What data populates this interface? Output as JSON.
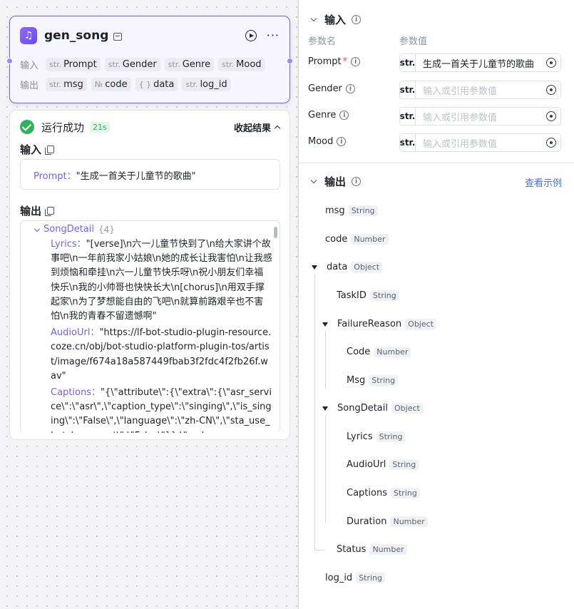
{
  "node": {
    "title": "gen_song",
    "inputs_label": "输入",
    "outputs_label": "输出",
    "inputs": [
      {
        "type": "str.",
        "name": "Prompt"
      },
      {
        "type": "str.",
        "name": "Gender"
      },
      {
        "type": "str.",
        "name": "Genre"
      },
      {
        "type": "str.",
        "name": "Mood"
      }
    ],
    "outputs": [
      {
        "type": "str.",
        "name": "msg"
      },
      {
        "type": "№",
        "name": "code"
      },
      {
        "type": "{ }",
        "name": "data"
      },
      {
        "type": "str.",
        "name": "log_id"
      }
    ]
  },
  "result": {
    "status": "运行成功",
    "duration": "21s",
    "collapse_label": "收起结果",
    "input_title": "输入",
    "input_key": "Prompt",
    "input_value": "\"生成一首关于儿童节的歌曲\"",
    "output_title": "输出",
    "root_key": "SongDetail",
    "root_count": "{4}",
    "items": [
      {
        "key": "Lyrics",
        "value": "\"[verse]\\n六一儿童节快到了\\n给大家讲个故事吧\\n一年前我家小姑娘\\n她的成长让我害怕\\n让我感到烦恼和牵挂\\n六一儿童节快乐呀\\n祝小朋友们幸福快乐\\n我的小帅哥也快快长大\\n[chorus]\\n用双手撑起家\\n为了梦想能自由的飞吧\\n就算前路艰辛也不害怕\\n我的青春不留遗憾啊\""
      },
      {
        "key": "AudioUrl",
        "value": "\"https://lf-bot-studio-plugin-resource.coze.cn/obj/bot-studio-platform-plugin-tos/artist/image/f674a18a587449fbab3f2fdc4f2fb26f.wav\""
      },
      {
        "key": "Captions",
        "value": "\"{\\\"attribute\\\":{\\\"extra\\\":{\\\"asr_service\\\":\\\"asr\\\",\\\"caption_type\\\":\\\"singing\\\",\\\"is_singing\\\":\\\"False\\\",\\\"language\\\":\\\"zh-CN\\\",\\\"sta_use_batch_request\\\":\\\"False\\\"}},\\\"cod"
      }
    ]
  },
  "panel": {
    "input_title": "输入",
    "col_name": "参数名",
    "col_value": "参数值",
    "params": [
      {
        "name": "Prompt",
        "required": "*",
        "type": "str.",
        "value": "生成一首关于儿童节的歌曲",
        "placeholder": ""
      },
      {
        "name": "Gender",
        "required": "",
        "type": "str.",
        "value": "",
        "placeholder": "输入或引用参数值"
      },
      {
        "name": "Genre",
        "required": "",
        "type": "str.",
        "value": "",
        "placeholder": "输入或引用参数值"
      },
      {
        "name": "Mood",
        "required": "",
        "type": "str.",
        "value": "",
        "placeholder": "输入或引用参数值"
      }
    ],
    "output_title": "输出",
    "example_link": "查看示例",
    "outputs": [
      {
        "name": "msg",
        "type": "String"
      },
      {
        "name": "code",
        "type": "Number"
      },
      {
        "name": "data",
        "type": "Object"
      },
      {
        "name": "TaskID",
        "type": "String"
      },
      {
        "name": "FailureReason",
        "type": "Object"
      },
      {
        "name": "Code",
        "type": "Number"
      },
      {
        "name": "Msg",
        "type": "String"
      },
      {
        "name": "SongDetail",
        "type": "Object"
      },
      {
        "name": "Lyrics",
        "type": "String"
      },
      {
        "name": "AudioUrl",
        "type": "String"
      },
      {
        "name": "Captions",
        "type": "String"
      },
      {
        "name": "Duration",
        "type": "Number"
      },
      {
        "name": "Status",
        "type": "Number"
      },
      {
        "name": "log_id",
        "type": "String"
      }
    ]
  }
}
